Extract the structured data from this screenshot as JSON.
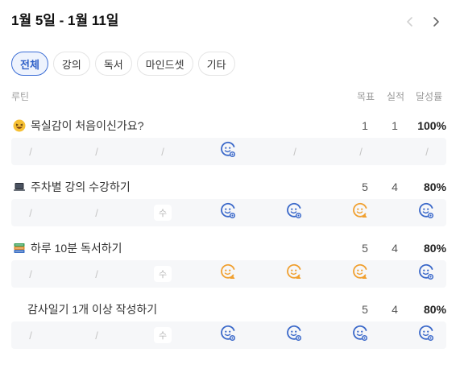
{
  "header": {
    "title": "1월 5일 - 1월 11일"
  },
  "tabs": [
    {
      "label": "전체",
      "active": true
    },
    {
      "label": "강의",
      "active": false
    },
    {
      "label": "독서",
      "active": false
    },
    {
      "label": "마인드셋",
      "active": false
    },
    {
      "label": "기타",
      "active": false
    }
  ],
  "columns": {
    "routine": "루틴",
    "goal": "목표",
    "actual": "실적",
    "rate": "달성률"
  },
  "routines": [
    {
      "icon": "laughing-face-emoji",
      "name": "목실감이 처음이신가요?",
      "goal": "1",
      "actual": "1",
      "rate": "100%",
      "days": [
        "/",
        "/",
        "/",
        "check",
        "/",
        "/",
        "/"
      ]
    },
    {
      "icon": "laptop-emoji",
      "name": "주차별 강의 수강하기",
      "goal": "5",
      "actual": "4",
      "rate": "80%",
      "days": [
        "/",
        "/",
        "수",
        "check",
        "check",
        "partial",
        "check"
      ]
    },
    {
      "icon": "books-emoji",
      "name": "하루 10분 독서하기",
      "goal": "5",
      "actual": "4",
      "rate": "80%",
      "days": [
        "/",
        "/",
        "수",
        "partial",
        "partial",
        "partial",
        "check"
      ]
    },
    {
      "icon": "",
      "name": "감사일기 1개 이상 작성하기",
      "goal": "5",
      "actual": "4",
      "rate": "80%",
      "days": [
        "/",
        "/",
        "수",
        "check",
        "check",
        "check",
        "check"
      ]
    }
  ],
  "colors": {
    "accent": "#3d6fd6",
    "check": "#3a68c9",
    "partial": "#f0a030"
  }
}
